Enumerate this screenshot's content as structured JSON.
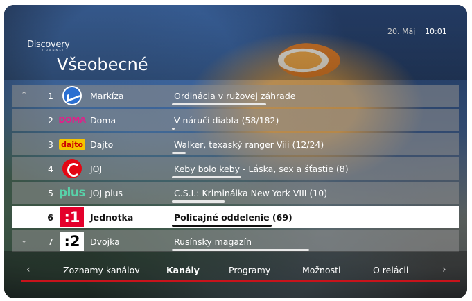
{
  "header": {
    "brand": "Discovery",
    "category_title": "Všeobecné",
    "date": "20. Máj",
    "time": "10:01"
  },
  "channels": [
    {
      "num": "1",
      "name": "Markíza",
      "program": "Ordinácia v ružovej záhrade",
      "progress": 0.68,
      "logo": "markiza-logo",
      "logo_text": ""
    },
    {
      "num": "2",
      "name": "Doma",
      "program": "V náručí diabla (58/182)",
      "progress": 0.02,
      "logo": "doma-logo",
      "logo_text": "DOMA"
    },
    {
      "num": "3",
      "name": "Dajto",
      "program": "Walker, texaský ranger Viii (12/24)",
      "progress": 0.1,
      "logo": "dajto-logo",
      "logo_text": "dajto"
    },
    {
      "num": "4",
      "name": "JOJ",
      "program": "Keby bolo keby - Láska, sex a šťastie (8)",
      "progress": 0.5,
      "logo": "joj-logo",
      "logo_text": ""
    },
    {
      "num": "5",
      "name": "JOJ plus",
      "program": "C.S.I.: Kriminálka New York VIII (10)",
      "progress": 0.38,
      "logo": "plus-logo",
      "logo_text": "plus"
    },
    {
      "num": "6",
      "name": "Jednotka",
      "program": "Policajné oddelenie (69)",
      "progress": 0.72,
      "logo": "j1-logo",
      "logo_text": ":1",
      "selected": true
    },
    {
      "num": "7",
      "name": "Dvojka",
      "program": "Rusínsky magazín",
      "progress": 0.99,
      "logo": "j2-logo",
      "logo_text": ":2"
    }
  ],
  "scroll": {
    "up": "⌃",
    "down": "⌄"
  },
  "tabs": {
    "left_arrow": "‹",
    "right_arrow": "›",
    "items": [
      {
        "label": "Zoznamy kanálov",
        "active": false
      },
      {
        "label": "Kanály",
        "active": true
      },
      {
        "label": "Programy",
        "active": false
      },
      {
        "label": "Možnosti",
        "active": false
      },
      {
        "label": "O relácii",
        "active": false
      }
    ]
  },
  "colors": {
    "accent": "#c8131b",
    "selected_bg": "#ffffff"
  }
}
